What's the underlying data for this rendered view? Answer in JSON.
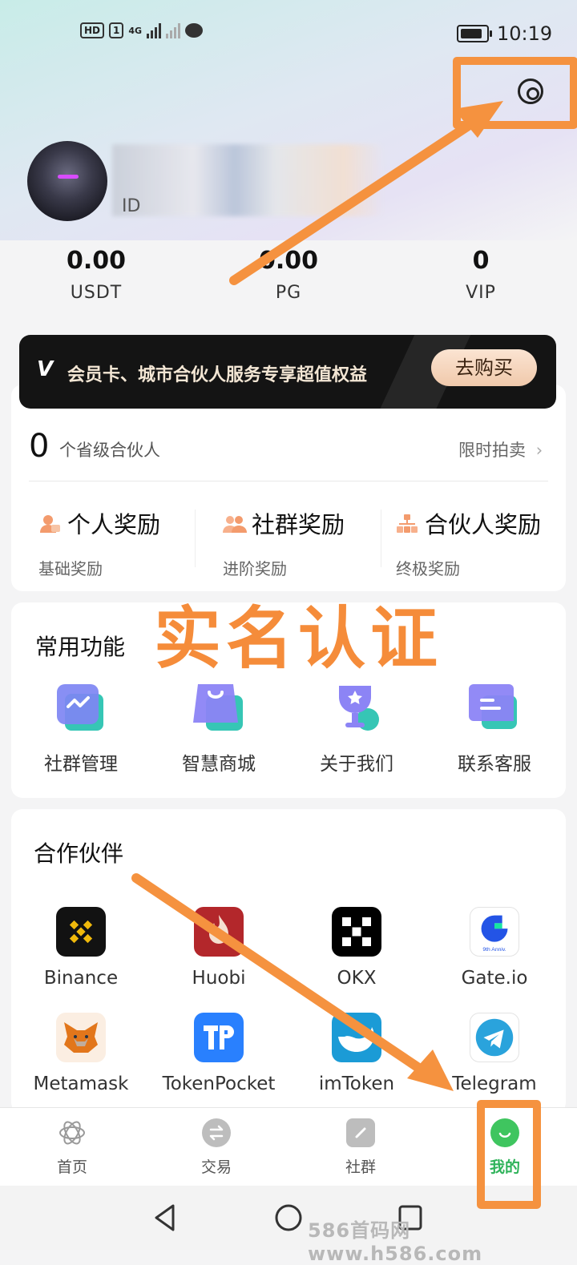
{
  "status_bar": {
    "hd": "HD",
    "sim": "1",
    "network": "4G",
    "time": "10:19"
  },
  "profile": {
    "id_prefix": "ID"
  },
  "stats": [
    {
      "value": "0.00",
      "label": "USDT"
    },
    {
      "value": "0.00",
      "label": "PG"
    },
    {
      "value": "0",
      "label": "VIP"
    }
  ],
  "banner": {
    "logo": "V",
    "text": "会员卡、城市合伙人服务专享超值权益",
    "button": "去购买"
  },
  "partner_card": {
    "count": "0",
    "count_label": "个省级合伙人",
    "auction": "限时拍卖",
    "rewards": [
      {
        "title": "个人奖励",
        "sub": "基础奖励"
      },
      {
        "title": "社群奖励",
        "sub": "进阶奖励"
      },
      {
        "title": "合伙人奖励",
        "sub": "终极奖励"
      }
    ]
  },
  "functions": {
    "title": "常用功能",
    "items": [
      {
        "label": "社群管理",
        "icon": "community-manage-icon"
      },
      {
        "label": "智慧商城",
        "icon": "shopping-bag-icon"
      },
      {
        "label": "关于我们",
        "icon": "trophy-icon"
      },
      {
        "label": "联系客服",
        "icon": "customer-service-icon"
      }
    ]
  },
  "annotation": {
    "text": "实名认证",
    "color": "#f58c3a"
  },
  "partners": {
    "title": "合作伙伴",
    "items": [
      {
        "label": "Binance",
        "icon": "binance-logo"
      },
      {
        "label": "Huobi",
        "icon": "huobi-logo"
      },
      {
        "label": "OKX",
        "icon": "okx-logo"
      },
      {
        "label": "Gate.io",
        "icon": "gateio-logo"
      },
      {
        "label": "Metamask",
        "icon": "metamask-logo"
      },
      {
        "label": "TokenPocket",
        "icon": "tokenpocket-logo"
      },
      {
        "label": "imToken",
        "icon": "imtoken-logo"
      },
      {
        "label": "Telegram",
        "icon": "telegram-logo"
      }
    ]
  },
  "tabs": [
    {
      "label": "首页",
      "icon": "home-icon"
    },
    {
      "label": "交易",
      "icon": "exchange-icon"
    },
    {
      "label": "社群",
      "icon": "community-icon"
    },
    {
      "label": "我的",
      "icon": "profile-icon",
      "active": true
    }
  ],
  "watermark": "586首码网 www.h586.com",
  "colors": {
    "accent_green": "#2fb35a",
    "annotation_orange": "#f58c3a",
    "banner_bg": "#141414"
  }
}
